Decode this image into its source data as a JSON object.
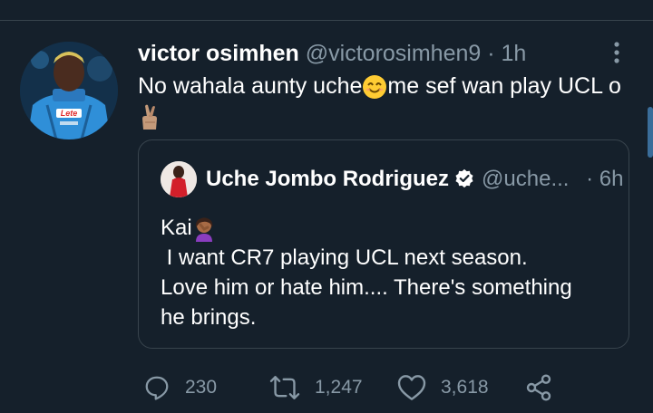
{
  "tweet": {
    "author_name": "victor osimhen",
    "handle": "@victorosimhen9",
    "separator": "·",
    "time": "1h",
    "text_part1": "No wahala aunty uche",
    "text_part2": "me sef wan play UCL o",
    "emojis": [
      "smiling-face-emoji",
      "crossed-fingers-emoji"
    ]
  },
  "quoted_tweet": {
    "author_name": "Uche Jombo Rodriguez",
    "handle": "@uche...",
    "separator": "·",
    "time": "6h",
    "line1": "Kai",
    "line2": " I want CR7 playing UCL next season.",
    "line3": "Love him or hate him.... There's something",
    "line4": "he brings.",
    "emoji": "facepalm-emoji"
  },
  "actions": {
    "replies": "230",
    "retweets": "1,247",
    "likes": "3,618"
  },
  "avatar_jersey_text": "Lete",
  "colors": {
    "background": "#15202b",
    "muted": "#8899a6",
    "border": "#38444d",
    "accent": "#1da1f2"
  }
}
